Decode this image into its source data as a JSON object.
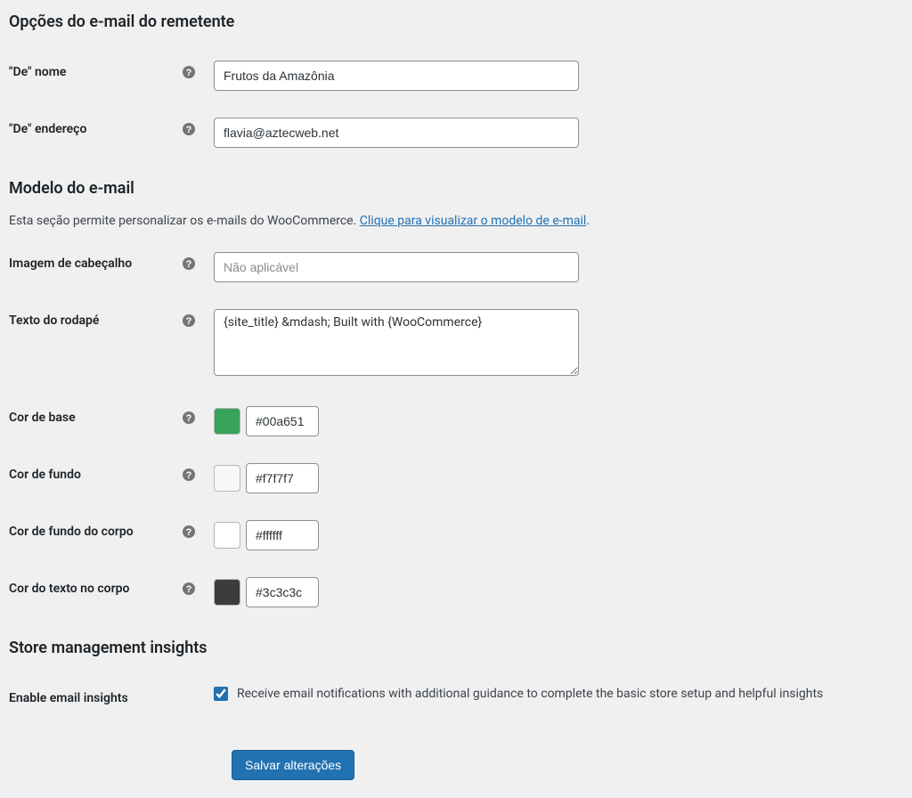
{
  "sections": {
    "sender": {
      "title": "Opções do e-mail do remetente",
      "from_name": {
        "label": "\"De\" nome",
        "value": "Frutos da Amazônia"
      },
      "from_address": {
        "label": "\"De\" endereço",
        "value": "flavia@aztecweb.net"
      }
    },
    "template": {
      "title": "Modelo do e-mail",
      "description_prefix": "Esta seção permite personalizar os e-mails do WooCommerce. ",
      "description_link": "Clique para visualizar o modelo de e-mail",
      "description_suffix": ".",
      "header_image": {
        "label": "Imagem de cabeçalho",
        "placeholder": "Não aplicável",
        "value": ""
      },
      "footer_text": {
        "label": "Texto do rodapé",
        "value": "{site_title} &mdash; Built with {WooCommerce}"
      },
      "base_color": {
        "label": "Cor de base",
        "value": "#00a651",
        "swatch": "#39a35b"
      },
      "background_color": {
        "label": "Cor de fundo",
        "value": "#f7f7f7",
        "swatch": "#f7f7f7"
      },
      "body_background": {
        "label": "Cor de fundo do corpo",
        "value": "#ffffff",
        "swatch": "#ffffff"
      },
      "body_text": {
        "label": "Cor do texto no corpo",
        "value": "#3c3c3c",
        "swatch": "#3c3c3c"
      }
    },
    "insights": {
      "title": "Store management insights",
      "enable": {
        "label": "Enable email insights",
        "checkbox_label": "Receive email notifications with additional guidance to complete the basic store setup and helpful insights",
        "checked": true
      }
    }
  },
  "buttons": {
    "save": "Salvar alterações"
  }
}
